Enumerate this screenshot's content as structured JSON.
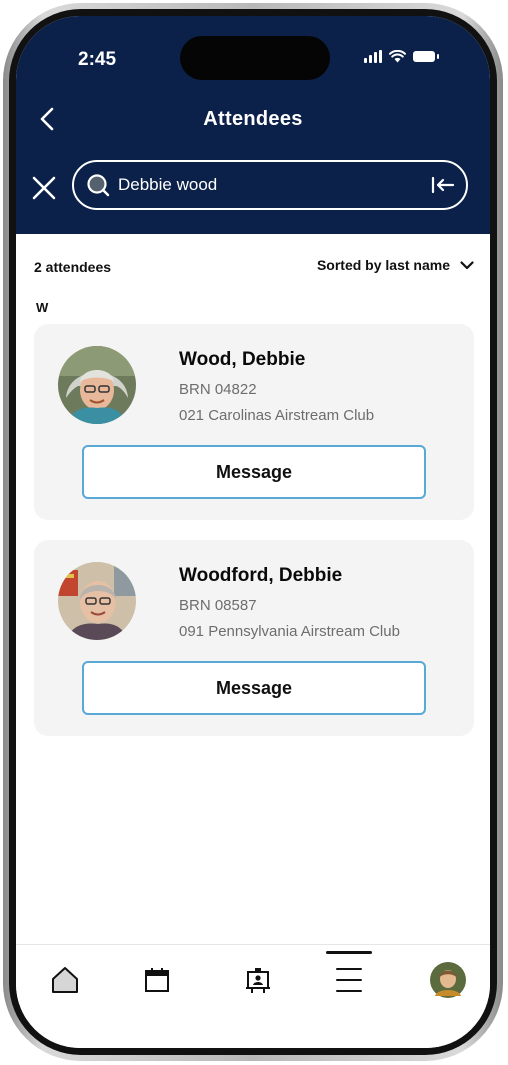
{
  "status_bar": {
    "time": "2:45"
  },
  "header": {
    "title": "Attendees"
  },
  "search": {
    "value": "Debbie wood",
    "placeholder": ""
  },
  "list": {
    "count_label": "2 attendees",
    "sort_label": "Sorted by last name",
    "section_letter": "W",
    "attendees": [
      {
        "name": "Wood, Debbie",
        "brn": "BRN 04822",
        "club": "021 Carolinas Airstream Club",
        "button_label": "Message"
      },
      {
        "name": "Woodford, Debbie",
        "brn": "BRN 08587",
        "club": "091 Pennsylvania Airstream Club",
        "button_label": "Message"
      }
    ]
  },
  "tab_bar": {
    "tabs": [
      "home-icon",
      "calendar-icon",
      "badge-icon",
      "menu-icon",
      "profile-avatar"
    ],
    "active_tab": "menu-icon"
  },
  "colors": {
    "header_bg": "#0b2149",
    "button_border": "#58a9d6",
    "card_bg": "#f4f4f4"
  }
}
